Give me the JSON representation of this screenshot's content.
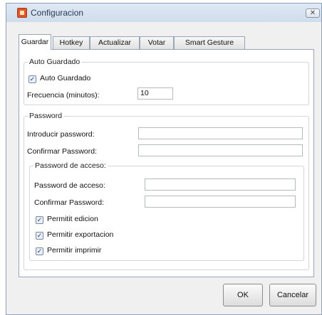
{
  "window": {
    "title": "Configuracion",
    "close_glyph": "✕",
    "icon": "app-settings-icon"
  },
  "tabs": [
    {
      "label": "Guardar",
      "active": true
    },
    {
      "label": "Hotkey",
      "active": false
    },
    {
      "label": "Actualizar",
      "active": false
    },
    {
      "label": "Votar",
      "active": false
    },
    {
      "label": "Smart Gesture",
      "active": false
    }
  ],
  "auto_guardado": {
    "legend": "Auto Guardado",
    "checkbox_label": "Auto Guardado",
    "checked": true,
    "frequency_label": "Frecuencia (minutos):",
    "frequency_value": "10"
  },
  "password": {
    "legend": "Password",
    "enter_label": "Introducir password:",
    "enter_value": "",
    "confirm_label": "Confirmar Password:",
    "confirm_value": "",
    "acceso": {
      "legend": "Password de acceso:",
      "enter_label": "Password de acceso:",
      "enter_value": "",
      "confirm_label": "Confirmar Password:",
      "confirm_value": "",
      "checkboxes": [
        {
          "label": "Permitit edicion",
          "checked": true
        },
        {
          "label": "Permitir exportacion",
          "checked": true
        },
        {
          "label": "Permitir imprimir",
          "checked": true
        }
      ]
    }
  },
  "buttons": {
    "ok": "OK",
    "cancel": "Cancelar"
  },
  "check_glyph": "✓"
}
